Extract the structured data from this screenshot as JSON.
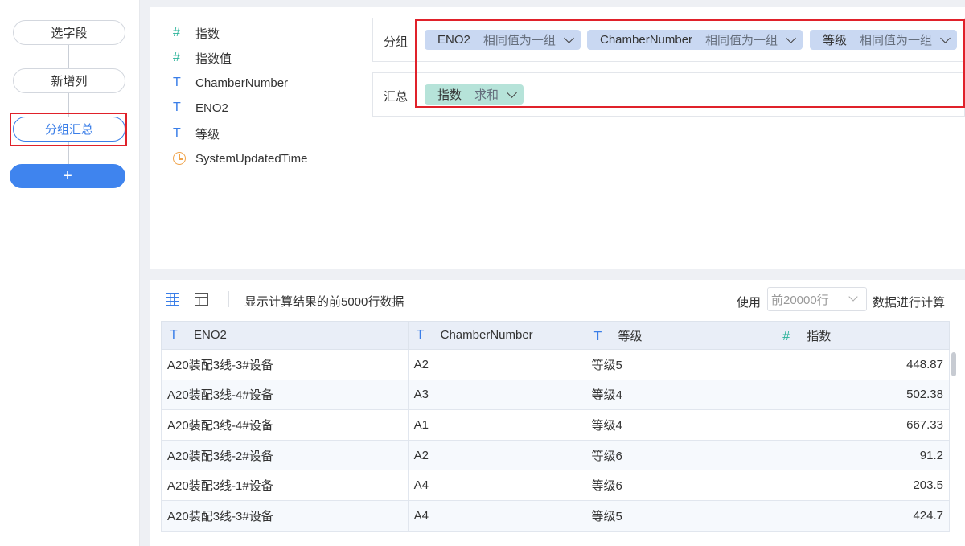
{
  "steps": [
    {
      "label": "选字段"
    },
    {
      "label": "新增列"
    },
    {
      "label": "分组汇总"
    }
  ],
  "add_step_label": "+",
  "fields": [
    {
      "type_icon": "#",
      "name": "指数"
    },
    {
      "type_icon": "#",
      "name": "指数值"
    },
    {
      "type_icon": "T",
      "name": "ChamberNumber"
    },
    {
      "type_icon": "T",
      "name": "ENO2"
    },
    {
      "type_icon": "T",
      "name": "等级"
    },
    {
      "type_icon": "clock-icon",
      "name": "SystemUpdatedTime"
    }
  ],
  "group_zone": {
    "label": "分组",
    "chips": [
      {
        "name": "ENO2",
        "mode": "相同值为一组"
      },
      {
        "name": "ChamberNumber",
        "mode": "相同值为一组"
      },
      {
        "name": "等级",
        "mode": "相同值为一组"
      }
    ]
  },
  "summary_zone": {
    "label": "汇总",
    "chips": [
      {
        "name": "指数",
        "mode": "求和"
      }
    ]
  },
  "toolbar": {
    "info": "显示计算结果的前5000行数据",
    "use_label": "使用",
    "rows_select_placeholder": "前20000行",
    "calc_label": "数据进行计算"
  },
  "table": {
    "columns": [
      {
        "type_icon": "T",
        "name": "ENO2"
      },
      {
        "type_icon": "T",
        "name": "ChamberNumber"
      },
      {
        "type_icon": "T",
        "name": "等级"
      },
      {
        "type_icon": "#",
        "name": "指数"
      }
    ],
    "rows": [
      [
        "A20装配3线-3#设备",
        "A2",
        "等级5",
        "448.87"
      ],
      [
        "A20装配3线-4#设备",
        "A3",
        "等级4",
        "502.38"
      ],
      [
        "A20装配3线-4#设备",
        "A1",
        "等级4",
        "667.33"
      ],
      [
        "A20装配3线-2#设备",
        "A2",
        "等级6",
        "91.2"
      ],
      [
        "A20装配3线-1#设备",
        "A4",
        "等级6",
        "203.5"
      ],
      [
        "A20装配3线-3#设备",
        "A4",
        "等级5",
        "424.7"
      ]
    ]
  },
  "colors": {
    "accent": "#3a7ee8",
    "highlight": "#e0212a",
    "group_chip": "#c9d8f2",
    "summary_chip": "#b6e3d9"
  }
}
